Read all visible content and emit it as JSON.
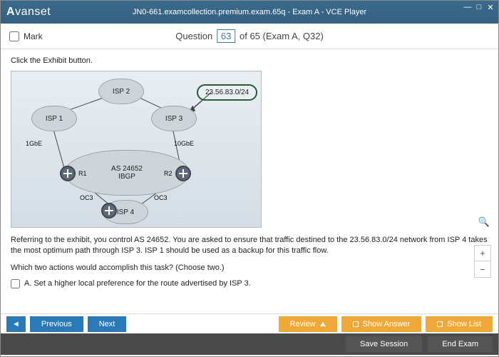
{
  "titlebar": {
    "logo": "Avanset",
    "title": "JN0-661.examcollection.premium.exam.65q - Exam A - VCE Player"
  },
  "header": {
    "mark": "Mark",
    "question_label": "Question",
    "qnum": "63",
    "of": " of 65 (Exam A, Q32)"
  },
  "content": {
    "exhibit": "Click the Exhibit button.",
    "diagram": {
      "isp1": "ISP 1",
      "isp2": "ISP 2",
      "isp3": "ISP 3",
      "isp4": "ISP 4",
      "as_num": "AS 24652",
      "ibgp": "IBGP",
      "r1": "R1",
      "r2": "R2",
      "link1": "1GbE",
      "link2": "10GbE",
      "oc3a": "OC3",
      "oc3b": "OC3",
      "prefix": "23.56.83.0/24"
    },
    "qtext": "Referring to the exhibit, you control AS 24652. You are asked to ensure that traffic destined to the 23.56.83.0/24 network from ISP 4 takes the most optimum path through ISP 3. ISP 1 should be used as a backup for this traffic flow.",
    "subq": "Which two actions would accomplish this task? (Choose two.)",
    "optA": "A.   Set a higher local preference for the route advertised by ISP 3."
  },
  "buttons": {
    "prev": "Previous",
    "next": "Next",
    "review": "Review",
    "show_answer": "Show Answer",
    "show_list": "Show List",
    "save": "Save Session",
    "end": "End Exam"
  }
}
